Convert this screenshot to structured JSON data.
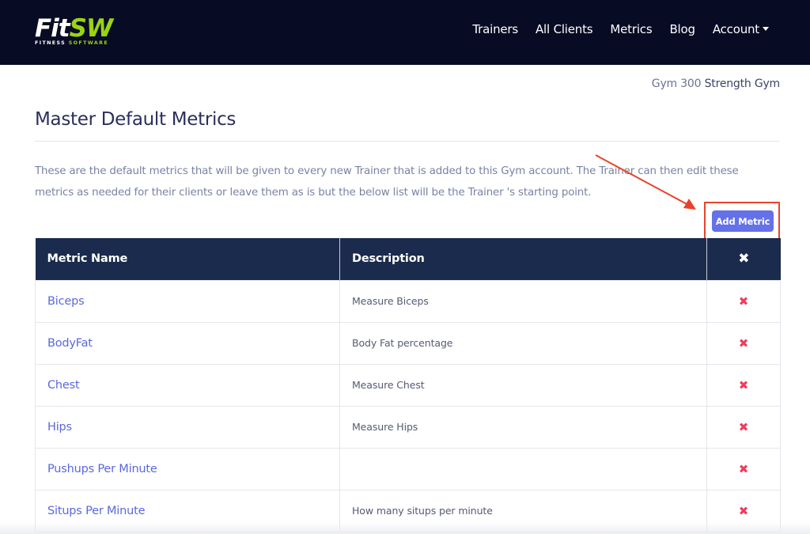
{
  "brand": {
    "logo_fit": "Fit",
    "logo_sw": "SW",
    "logo_sub_fitness": "FITNESS",
    "logo_sub_software": "SOFTWARE",
    "colors": {
      "navbar_bg": "#070b24",
      "accent_green": "#9ad411",
      "button": "#6471e8",
      "table_header": "#1a2b4d",
      "link": "#5a68dc",
      "delete": "#ee3d5f",
      "annotation": "#e8432a"
    }
  },
  "nav": {
    "items": [
      {
        "label": "Trainers"
      },
      {
        "label": "All Clients"
      },
      {
        "label": "Metrics"
      },
      {
        "label": "Blog"
      },
      {
        "label": "Account"
      }
    ]
  },
  "gym": {
    "prefix": "Gym 300",
    "name": "Strength Gym"
  },
  "page": {
    "title": "Master Default Metrics",
    "intro": "These are the default metrics that will be given to every new Trainer that is added to this Gym account. The Trainer can then edit these metrics as needed for their clients or leave them as is but the below list will be the Trainer 's starting point.",
    "add_button": "Add Metric"
  },
  "table": {
    "headers": {
      "name": "Metric Name",
      "description": "Description",
      "delete": "✖"
    },
    "delete_glyph": "✖",
    "rows": [
      {
        "name": "Biceps",
        "description": "Measure Biceps"
      },
      {
        "name": "BodyFat",
        "description": "Body Fat percentage"
      },
      {
        "name": "Chest",
        "description": "Measure Chest"
      },
      {
        "name": "Hips",
        "description": "Measure Hips"
      },
      {
        "name": "Pushups Per Minute",
        "description": ""
      },
      {
        "name": "Situps Per Minute",
        "description": "How many situps per minute"
      }
    ]
  }
}
